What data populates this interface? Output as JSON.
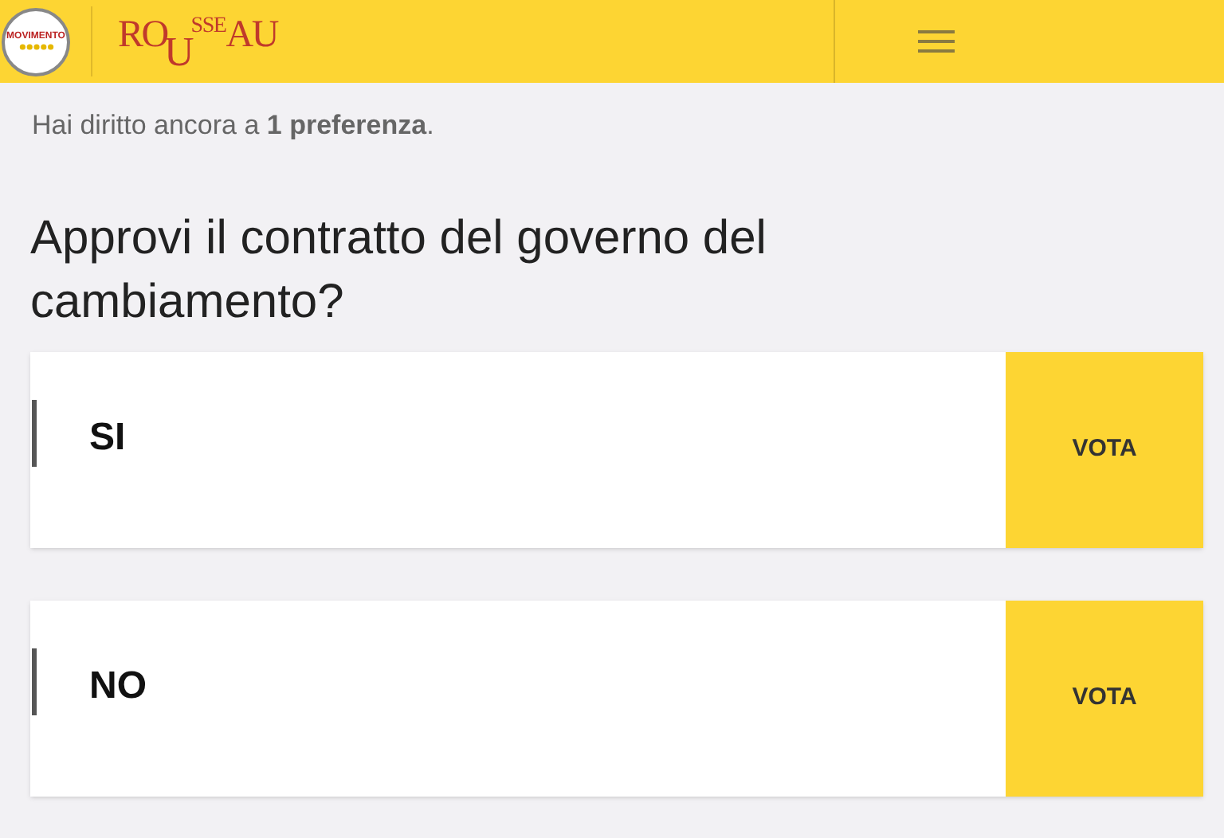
{
  "header": {
    "logo_text": "MOVIMENTO",
    "brand": [
      {
        "text": "RO",
        "kind": "base"
      },
      {
        "text": "U",
        "kind": "low"
      },
      {
        "text": "SSE",
        "kind": "high"
      },
      {
        "text": "AU",
        "kind": "base"
      }
    ]
  },
  "notice": "Hai diritto ancora a **1 preferenza**.",
  "question": "Approvi il contratto del governo del cambiamento?",
  "options": [
    {
      "label": "SI",
      "button": "VOTA"
    },
    {
      "label": "NO",
      "button": "VOTA"
    }
  ]
}
